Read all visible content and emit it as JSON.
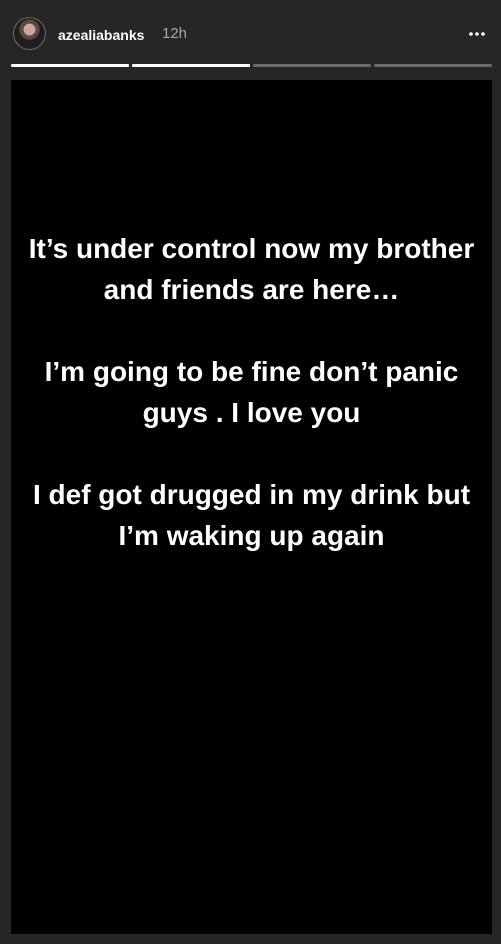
{
  "header": {
    "username": "azealiabanks",
    "timestamp": "12h",
    "more_icon": "more-horizontal-icon"
  },
  "progress": {
    "segments": [
      1,
      1,
      0,
      0
    ]
  },
  "story": {
    "paragraphs": [
      "It’s under control now my brother and friends are here…",
      "I’m going to be fine don’t panic guys . I love you",
      "I def got drugged in my drink but I’m waking up again"
    ]
  }
}
